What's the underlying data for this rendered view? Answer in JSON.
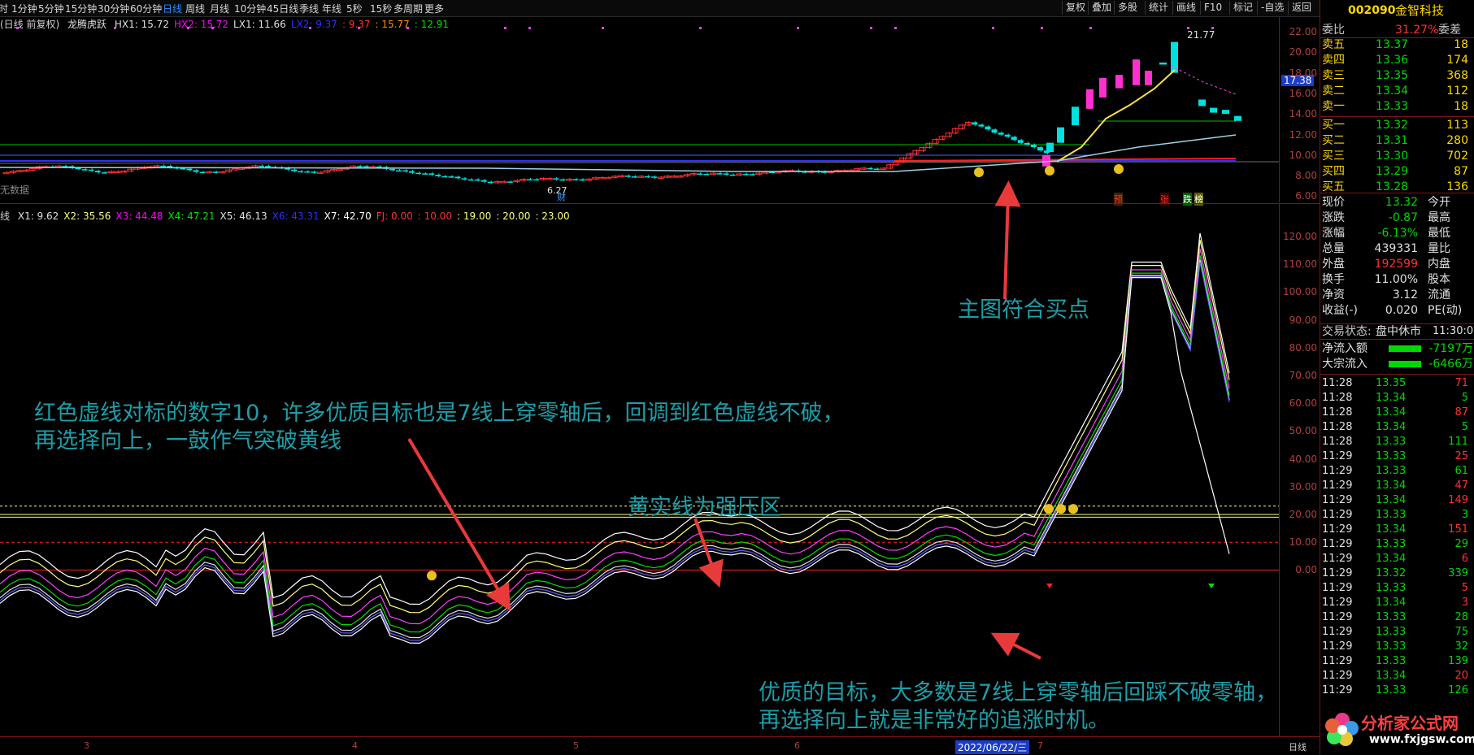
{
  "periods": [
    "分时",
    "1分钟",
    "5分钟",
    "15分钟",
    "30分钟",
    "60分钟",
    "日线",
    "周线",
    "月线",
    "10分钟",
    "45日线",
    "季线",
    "年线",
    "5秒",
    "15秒",
    "多周期",
    "更多"
  ],
  "active_period": "日线",
  "toolbar_right": [
    "复权",
    "叠加",
    "多股",
    "统计",
    "画线",
    "F10",
    "标记",
    "-自选",
    "返回"
  ],
  "main_legend": {
    "prefix": "(日线 前复权)",
    "name": "龙腾虎跃",
    "items": [
      {
        "label": "HX1: 15.72",
        "color": "#e0e0e0"
      },
      {
        "label": "HX2: 15.72",
        "color": "#ff00ff"
      },
      {
        "label": "LX1: 11.66",
        "color": "#e0e0e0"
      },
      {
        "label": "LX2: 9.37",
        "color": "#3030ff"
      },
      {
        "label": ": 9.37",
        "color": "#ff3030"
      },
      {
        "label": ": 15.77",
        "color": "#ff8c00"
      },
      {
        "label": ": 12.91",
        "color": "#00e000"
      }
    ]
  },
  "main_axis": [
    "22.00",
    "20.00",
    "18.00",
    "16.00",
    "14.00",
    "12.00",
    "10.00",
    "8.00",
    "6.00"
  ],
  "price_tag": "17.38",
  "high_label": "21.77",
  "low_label": "6.27",
  "no_data": "无数据",
  "cai_marker": "财",
  "event_markers": [
    "$",
    "预",
    "张",
    "跌",
    "榜"
  ],
  "sub_legend": {
    "prefix": "线",
    "items": [
      {
        "label": "X1: 9.62",
        "color": "#e0e0e0"
      },
      {
        "label": "X2: 35.56",
        "color": "#ffff80"
      },
      {
        "label": "X3: 44.48",
        "color": "#ff00ff"
      },
      {
        "label": "X4: 47.21",
        "color": "#00e000"
      },
      {
        "label": "X5: 46.13",
        "color": "#e0e0e0"
      },
      {
        "label": "X6: 43.31",
        "color": "#3030ff"
      },
      {
        "label": "X7: 42.70",
        "color": "#ffffff"
      },
      {
        "label": "FJ: 0.00",
        "color": "#ff3030"
      },
      {
        "label": ": 10.00",
        "color": "#ff3030"
      },
      {
        "label": ": 19.00",
        "color": "#ffff80"
      },
      {
        "label": ": 20.00",
        "color": "#ffff80"
      },
      {
        "label": ": 23.00",
        "color": "#ffff80"
      }
    ]
  },
  "sub_axis": [
    "120.00",
    "110.00",
    "100.00",
    "90.00",
    "80.00",
    "70.00",
    "60.00",
    "50.00",
    "40.00",
    "30.00",
    "20.00",
    "10.00",
    "0.00"
  ],
  "annotations": {
    "buy_point": "主图符合买点",
    "red_dashed": "红色虚线对标的数字10，许多优质目标也是7线上穿零轴后，回调到红色虚线不破，",
    "red_dashed2": "再选择向上，一鼓作气突破黄线",
    "yellow_zone": "黄实线为强压区",
    "quality": "优质的目标，大多数是7线上穿零轴后回踩不破零轴，",
    "quality2": "再选择向上就是非常好的追涨时机。"
  },
  "x_axis": {
    "labels": [
      "3",
      "4",
      "5",
      "6",
      "7"
    ],
    "date": "2022/06/22/三",
    "period": "日线"
  },
  "quote": {
    "code": "002090",
    "name": "金智科技",
    "weibi_label": "委比",
    "weibi": "31.27%",
    "weicha_label": "委差",
    "sells": [
      {
        "label": "卖五",
        "price": "13.37",
        "vol": "18"
      },
      {
        "label": "卖四",
        "price": "13.36",
        "vol": "174"
      },
      {
        "label": "卖三",
        "price": "13.35",
        "vol": "368"
      },
      {
        "label": "卖二",
        "price": "13.34",
        "vol": "112"
      },
      {
        "label": "卖一",
        "price": "13.33",
        "vol": "18"
      }
    ],
    "buys": [
      {
        "label": "买一",
        "price": "13.32",
        "vol": "113"
      },
      {
        "label": "买二",
        "price": "13.31",
        "vol": "280"
      },
      {
        "label": "买三",
        "price": "13.30",
        "vol": "702"
      },
      {
        "label": "买四",
        "price": "13.29",
        "vol": "87"
      },
      {
        "label": "买五",
        "price": "13.28",
        "vol": "136"
      }
    ],
    "stats": [
      {
        "l": "现价",
        "v": "13.32",
        "r": "今开",
        "vc": "#00d800"
      },
      {
        "l": "涨跌",
        "v": "-0.87",
        "r": "最高",
        "vc": "#00d800"
      },
      {
        "l": "涨幅",
        "v": "-6.13%",
        "r": "最低",
        "vc": "#00d800"
      },
      {
        "l": "总量",
        "v": "439331",
        "r": "量比",
        "vc": "#e0e0e0"
      },
      {
        "l": "外盘",
        "v": "192599",
        "r": "内盘",
        "vc": "#ff3030"
      },
      {
        "l": "换手",
        "v": "11.00%",
        "r": "股本",
        "vc": "#e0e0e0"
      },
      {
        "l": "净资",
        "v": "3.12",
        "r": "流通",
        "vc": "#e0e0e0"
      },
      {
        "l": "收益(-)",
        "v": "0.020",
        "r": "PE(动)",
        "vc": "#e0e0e0"
      }
    ],
    "status_label": "交易状态:",
    "status": "盘中休市",
    "status_time": "11:30:0",
    "flows": [
      {
        "l": "净流入额",
        "v": "-7197万"
      },
      {
        "l": "大宗流入",
        "v": "-6466万"
      }
    ],
    "trades": [
      {
        "t": "11:28",
        "p": "13.35",
        "v": "71",
        "vc": "#ff3030"
      },
      {
        "t": "11:28",
        "p": "13.34",
        "v": "5",
        "vc": "#00d800"
      },
      {
        "t": "11:28",
        "p": "13.34",
        "v": "87",
        "vc": "#ff3030"
      },
      {
        "t": "11:28",
        "p": "13.34",
        "v": "5",
        "vc": "#00d800"
      },
      {
        "t": "11:28",
        "p": "13.33",
        "v": "111",
        "vc": "#00d800"
      },
      {
        "t": "11:29",
        "p": "13.33",
        "v": "25",
        "vc": "#ff3030"
      },
      {
        "t": "11:29",
        "p": "13.33",
        "v": "61",
        "vc": "#00d800"
      },
      {
        "t": "11:29",
        "p": "13.34",
        "v": "47",
        "vc": "#ff3030"
      },
      {
        "t": "11:29",
        "p": "13.34",
        "v": "149",
        "vc": "#ff3030"
      },
      {
        "t": "11:29",
        "p": "13.33",
        "v": "3",
        "vc": "#00d800"
      },
      {
        "t": "11:29",
        "p": "13.34",
        "v": "151",
        "vc": "#ff3030"
      },
      {
        "t": "11:29",
        "p": "13.33",
        "v": "29",
        "vc": "#00d800"
      },
      {
        "t": "11:29",
        "p": "13.34",
        "v": "6",
        "vc": "#ff3030"
      },
      {
        "t": "11:29",
        "p": "13.32",
        "v": "339",
        "vc": "#00d800"
      },
      {
        "t": "11:29",
        "p": "13.33",
        "v": "5",
        "vc": "#ff3030"
      },
      {
        "t": "11:29",
        "p": "13.34",
        "v": "3",
        "vc": "#ff3030"
      },
      {
        "t": "11:29",
        "p": "13.33",
        "v": "28",
        "vc": "#00d800"
      },
      {
        "t": "11:29",
        "p": "13.33",
        "v": "75",
        "vc": "#00d800"
      },
      {
        "t": "11:29",
        "p": "13.33",
        "v": "32",
        "vc": "#00d800"
      },
      {
        "t": "11:29",
        "p": "13.33",
        "v": "139",
        "vc": "#00d800"
      },
      {
        "t": "11:29",
        "p": "13.34",
        "v": "20",
        "vc": "#ff3030"
      },
      {
        "t": "11:29",
        "p": "13.33",
        "v": "126",
        "vc": "#00d800"
      }
    ]
  },
  "watermark": {
    "title": "分析家公式网",
    "url": "www.fxjgsw.com"
  }
}
